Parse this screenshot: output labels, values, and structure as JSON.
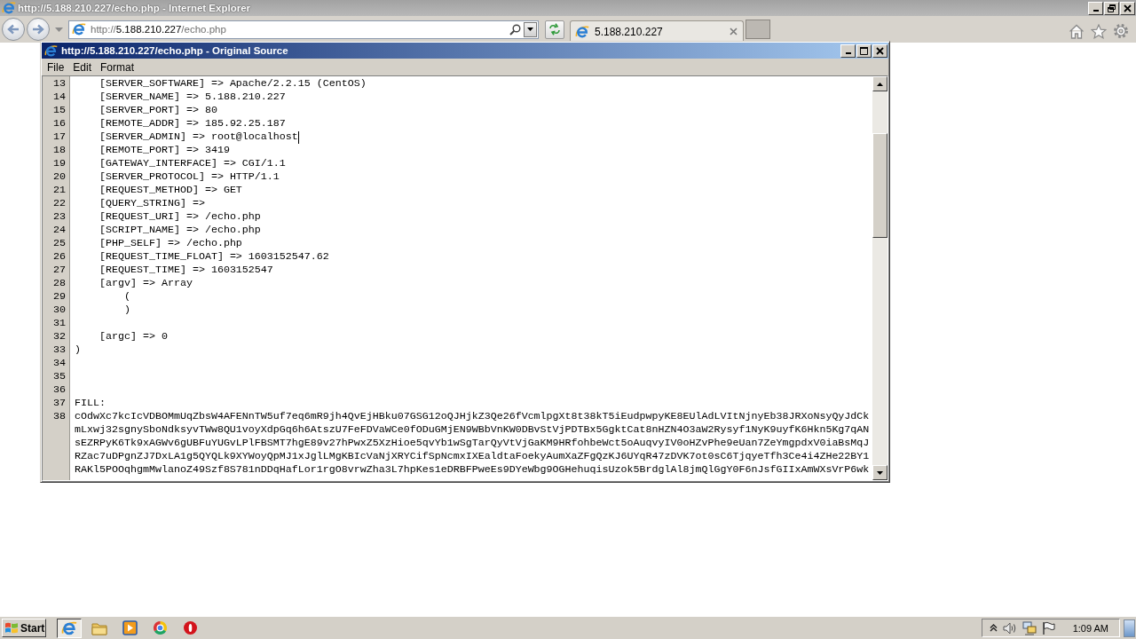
{
  "browser": {
    "title": "http://5.188.210.227/echo.php - Internet Explorer",
    "address": "http://5.188.210.227/echo.php",
    "tabs": [
      {
        "label": "5.188.210.227",
        "selected": true
      }
    ]
  },
  "source_window": {
    "title": "http://5.188.210.227/echo.php - Original Source",
    "menu": [
      "File",
      "Edit",
      "Format"
    ],
    "lines": [
      {
        "number": "13",
        "text": "    [SERVER_SOFTWARE] => Apache/2.2.15 (CentOS)",
        "caret": false
      },
      {
        "number": "14",
        "text": "    [SERVER_NAME] => 5.188.210.227",
        "caret": false
      },
      {
        "number": "15",
        "text": "    [SERVER_PORT] => 80",
        "caret": false
      },
      {
        "number": "16",
        "text": "    [REMOTE_ADDR] => 185.92.25.187",
        "caret": false
      },
      {
        "number": "17",
        "text": "    [SERVER_ADMIN] => root@localhost",
        "caret": true
      },
      {
        "number": "18",
        "text": "    [REMOTE_PORT] => 3419",
        "caret": false
      },
      {
        "number": "19",
        "text": "    [GATEWAY_INTERFACE] => CGI/1.1",
        "caret": false
      },
      {
        "number": "20",
        "text": "    [SERVER_PROTOCOL] => HTTP/1.1",
        "caret": false
      },
      {
        "number": "21",
        "text": "    [REQUEST_METHOD] => GET",
        "caret": false
      },
      {
        "number": "22",
        "text": "    [QUERY_STRING] =>",
        "caret": false
      },
      {
        "number": "23",
        "text": "    [REQUEST_URI] => /echo.php",
        "caret": false
      },
      {
        "number": "24",
        "text": "    [SCRIPT_NAME] => /echo.php",
        "caret": false
      },
      {
        "number": "25",
        "text": "    [PHP_SELF] => /echo.php",
        "caret": false
      },
      {
        "number": "26",
        "text": "    [REQUEST_TIME_FLOAT] => 1603152547.62",
        "caret": false
      },
      {
        "number": "27",
        "text": "    [REQUEST_TIME] => 1603152547",
        "caret": false
      },
      {
        "number": "28",
        "text": "    [argv] => Array",
        "caret": false
      },
      {
        "number": "29",
        "text": "        (",
        "caret": false
      },
      {
        "number": "30",
        "text": "        )",
        "caret": false
      },
      {
        "number": "31",
        "caret": false
      },
      {
        "number": "32",
        "text": "    [argc] => 0",
        "caret": false
      },
      {
        "number": "33",
        "text": ")",
        "caret": false
      },
      {
        "number": "34",
        "caret": false
      },
      {
        "number": "35",
        "caret": false
      },
      {
        "number": "36",
        "caret": false
      },
      {
        "number": "37",
        "text": "FILL:",
        "caret": false
      },
      {
        "number": "38",
        "text": "cOdwXc7kcIcVDBOMmUqZbsW4AFENnTW5uf7eq6mR9jh4QvEjHBku07GSG12oQJHjkZ3Qe26fVcmlpgXt8t38kT5iEudpwpyKE8EUlAdLVItNjnyEb38JRXoNsyQyJdCkmLxwj32sgnySboNdksyvTWw8QU1voyXdpGq6h6AtszU7FeFDVaWCe0fODuGMjEN9WBbVnKW0DBvStVjPDTBx5GgktCat8nHZN4O3aW2Rysyf1NyK9uyfK6Hkn5Kg7qANsEZRPyK6Tk9xAGWv6gUBFuYUGvLPlFBSMT7hgE89v27hPwxZ5XzHioe5qvYb1wSgTarQyVtVjGaKM9HRfohbeWct5oAuqvyIV0oHZvPhe9eUan7ZeYmgpdxV0iaBsMqJRZac7uDPgnZJ7DxLA1g5QYQLk9XYWoyQpMJ1xJglLMgKBIcVaNjXRYCifSpNcmxIXEaldtaFoekyAumXaZFgQzKJ6UYqR47zDVK7ot0sC6TjqyeTfh3Ce4i4ZHe22BY1RAKl5POOqhgmMwlanoZ49Szf8S781nDDqHafLor1rgO8vrwZha3L7hpKes1eDRBFPweEs9DYeWbg9OGHehuqisUzok5BrdglAl8jmQlGgY0F6nJsfGIIxAmWXsVrP6wk",
        "caret": false
      }
    ]
  },
  "taskbar": {
    "start": "Start",
    "apps": [
      {
        "kind": "e-logo",
        "selected": true
      },
      {
        "kind": "folder",
        "selected": false
      },
      {
        "kind": "player",
        "selected": false
      },
      {
        "kind": "segmented-ring",
        "selected": false
      },
      {
        "kind": "oval-ring",
        "selected": false
      }
    ],
    "clock": "1:09 AM"
  }
}
